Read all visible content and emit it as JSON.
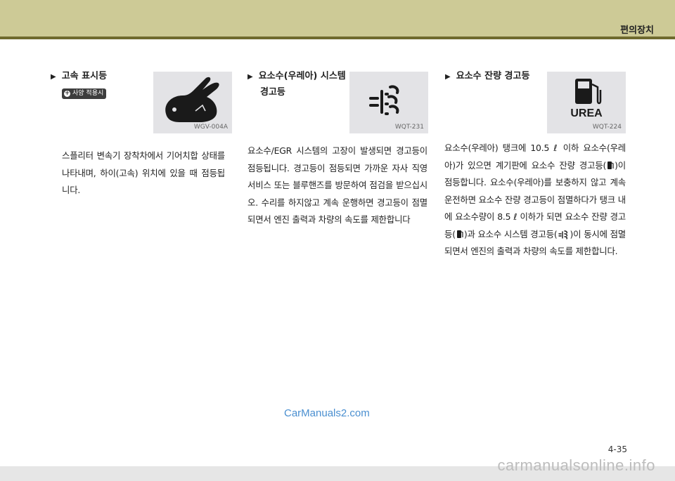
{
  "header": {
    "section_title": "편의장치"
  },
  "col1": {
    "heading": "고속 표시등",
    "badge": "사양 적용시",
    "image_code": "WGV-004A",
    "icon": "rabbit-icon",
    "body": "스플리터 변속기 장착차에서 기어치합 상태를 나타내며, 하이(고속) 위치에 있을 때 점등됩니다."
  },
  "col2": {
    "heading_line1": "요소수(우레아) 시스템",
    "heading_line2": "경고등",
    "image_code": "WQT-231",
    "icon": "urea-system-icon",
    "body": "요소수/EGR 시스템의 고장이 발생되면 경고등이 점등됩니다. 경고등이 점등되면 가까운 자사 직영 서비스 또는 블루핸즈를 방문하여 점검을 받으십시오. 수리를 하지않고 계속 운행하면 경고등이 점멸되면서 엔진 출력과 차량의 속도를 제한합니다"
  },
  "col3": {
    "heading": "요소수 잔량 경고등",
    "image_code": "WQT-224",
    "image_label": "UREA",
    "icon": "urea-level-icon",
    "body_p1": "요소수(우레아) 탱크에 10.5 ℓ 이하 요소수(우레아)가 있으면 계기판에 요소수 잔량 경고등(",
    "body_p2": ")이 점등합니다. 요소수(우레아)를 보충하지 않고 계속 운전하면 요소수 잔량 경고등이 점멸하다가 탱크 내에 요소수량이 8.5 ℓ 이하가 되면 요소수 잔량 경고등(",
    "body_p3": ")과 요소수 시스템 경고등(",
    "body_p4": ")이 동시에 점멸되면서 엔진의 출력과 차량의 속도를 제한합니다."
  },
  "watermark": "CarManuals2.com",
  "page_number": "4-35",
  "footer": {
    "url": "carmanualsonline.info"
  }
}
